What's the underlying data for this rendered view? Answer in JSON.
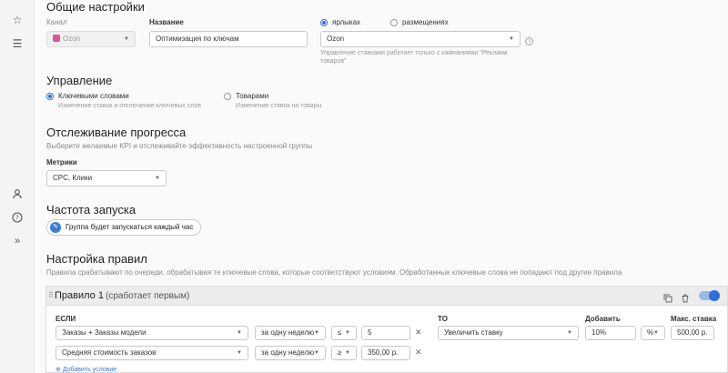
{
  "sidebar": {
    "icons": [
      "star-icon",
      "list-icon",
      "user-icon",
      "help-icon",
      "expand-icon"
    ]
  },
  "general": {
    "title": "Общие настройки",
    "channel_label": "Канал",
    "channel_value": "Ozon",
    "name_label": "Название",
    "name_value": "Оптимизация по ключам",
    "radio_labels": "ярлыках",
    "radio_placements": "размещениях",
    "platform_value": "Ozon",
    "platform_note": "Управление ставками работает только с кампаниями \"Реклама товаров\""
  },
  "control": {
    "title": "Управление",
    "opt1_label": "Ключевыми словами",
    "opt1_desc": "Изменение ставок и отключение ключевых слов",
    "opt2_label": "Товарами",
    "opt2_desc": "Изменение ставок на товары"
  },
  "progress": {
    "title": "Отслеживание прогресса",
    "desc": "Выберите желаемые KPI и отслеживайте эффективность настроенной группы",
    "metrics_label": "Метрики",
    "metrics_value": "CPC, Клики"
  },
  "frequency": {
    "title": "Частота запуска",
    "chip": "Группа будет запускаться каждый час"
  },
  "rules": {
    "title": "Настройка правил",
    "desc": "Правила срабатывают по очереди, обрабатывая те ключевые слова, которые соответствуют условиям. Обработанные ключевые слова не попадают под другие правила",
    "rule_title": "Правило 1",
    "rule_sub": "(сработает первым)",
    "if_label": "ЕСЛИ",
    "then_label": "ТО",
    "add_label": "Добавить",
    "max_label": "Макс. ставка",
    "cond1_metric": "Заказы + Заказы модели",
    "cond1_period": "за одну неделю",
    "cond1_op": "≤",
    "cond1_value": "5",
    "cond2_metric": "Средняя стоимость заказов",
    "cond2_period": "за одну неделю",
    "cond2_op": "≥",
    "cond2_value": "350,00 р.",
    "action": "Увеличить ставку",
    "action_amount": "10%",
    "action_unit": "%",
    "max_value": "500,00 р.",
    "add_condition": "Добавить условие"
  }
}
